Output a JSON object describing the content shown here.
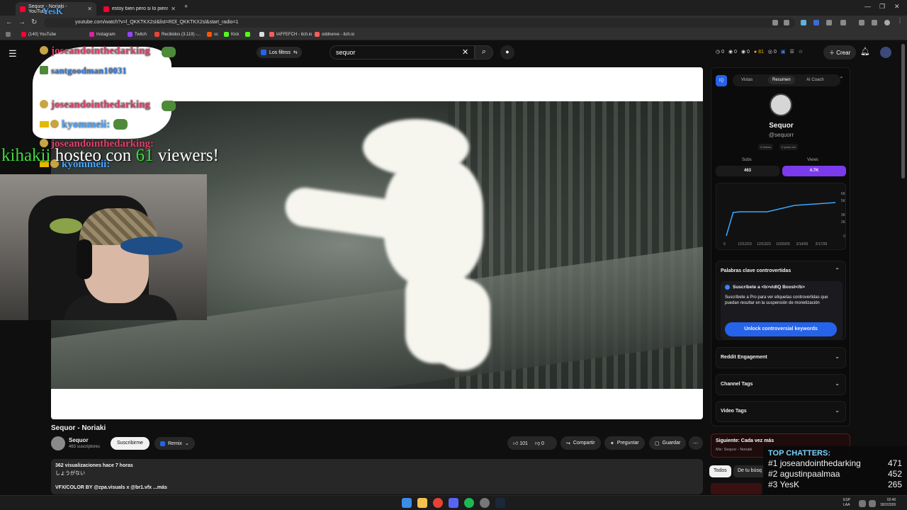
{
  "browser": {
    "tabs": [
      {
        "label": "Sequor - Noriaki - YouTube",
        "active": true
      },
      {
        "label": "estoy bien pero si lo pienso me",
        "active": false
      }
    ],
    "new_tab": "+",
    "url": "youtube.com/watch?v=l_QKKTKX2sl&list=RDl_QKKTKX2sl&start_radio=1",
    "bookmarks": [
      "(140) YouTube",
      "Instagram",
      "Twitch",
      "Recibidos (3.119) -...",
      "sc",
      "Kick",
      "IAFFEFCH - itch.io",
      "oddnerve - itch.io"
    ]
  },
  "youtube": {
    "filters_label": "Los filtros",
    "search_value": "sequor",
    "stats": [
      "0",
      "0",
      "0",
      "81",
      "0"
    ],
    "create_label": "Crear"
  },
  "video": {
    "title": "Sequor - Noriaki",
    "channel": "Sequor",
    "subscribers": "463 suscriptores",
    "subscribe_label": "Suscribirme",
    "remix_label": "Remix",
    "likes": "101",
    "dislikes": "0",
    "share_label": "Compartir",
    "ask_label": "Preguntar",
    "save_label": "Guardar",
    "views_time": "362 visualizaciones  hace 7 horas",
    "desc_line1": "しょうがない",
    "desc_line2": "VFX/COLOR BY @zpa.visuals x @br1.vfx",
    "more_label": "...más"
  },
  "stream_overlay": {
    "chat": [
      {
        "user": "joseandointhedarking",
        "color": "#e0416b"
      },
      {
        "user": "santgoodman10031",
        "color": "#3b7bd8"
      },
      {
        "user": "joseandointhedarking",
        "color": "#e0416b"
      },
      {
        "user": "kyommeii:",
        "color": "#4aa6ff"
      },
      {
        "user": "joseandointhedarking:",
        "color": "#e0416b"
      },
      {
        "user": "kyommeii:",
        "color": "#4aa6ff"
      }
    ],
    "top_name": "YesK",
    "host_user": "kihakii",
    "host_text": "hosteo con",
    "host_count": "61",
    "host_suffix": "viewers!"
  },
  "vidiq": {
    "tabs": [
      "Vistas",
      "Resumen",
      "AI Coach"
    ],
    "channel_name": "Sequor",
    "handle": "@sequorr",
    "meta": [
      "0 videos",
      "0 years old"
    ],
    "subs_label": "Subs",
    "subs_value": "463",
    "views_label": "Views",
    "views_value": "4.7K",
    "chart_data": {
      "type": "line",
      "x": [
        "12/12/23",
        "12/13/23",
        "10/20/25",
        "2/14/26",
        "2/17/26"
      ],
      "y_ticks": [
        "6K",
        "5K",
        "3K",
        "2K",
        "0"
      ],
      "y_label_zero": "0",
      "points": [
        [
          0,
          0
        ],
        [
          0.25,
          3.3
        ],
        [
          0.5,
          3.4
        ],
        [
          1.5,
          3.4
        ],
        [
          2.5,
          4.3
        ],
        [
          4,
          4.7
        ]
      ]
    },
    "keywords_title": "Palabras clave controvertidas",
    "keywords_sub": "Suscríbete a <b>vidIQ Boost</b>",
    "keywords_body": "Suscríbete a Pro para ver etiquetas controvertidas que puedan resultar en la suspensión de monetización",
    "unlock_label": "Unlock controversial keywords",
    "sections": [
      "Reddit Engagement",
      "Channel Tags",
      "Video Tags"
    ]
  },
  "next_up": {
    "title": "Siguiente: Cada vez más",
    "sub": "Mix: Sequor - Noriaki"
  },
  "chips": [
    "Todos",
    "De tu búsq"
  ],
  "top_chatters": {
    "title": "TOP CHATTERS:",
    "rows": [
      {
        "rank": "#1",
        "name": "joseandointhedarking",
        "count": "471"
      },
      {
        "rank": "#2",
        "name": "agustinpaalmaa",
        "count": "452"
      },
      {
        "rank": "#3",
        "name": "YesK",
        "count": "265"
      }
    ]
  },
  "taskbar": {
    "lang": "ESP",
    "lang2": "LAA",
    "time": "02:40",
    "date": "18/2/2026"
  }
}
